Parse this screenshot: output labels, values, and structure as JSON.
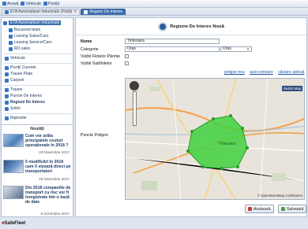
{
  "topbar": {
    "items": [
      {
        "label": "Acasă",
        "icon": "home-icon"
      },
      {
        "label": "Vehicule",
        "icon": "truck-icon"
      },
      {
        "label": "Poziții",
        "icon": "map-pin-icon"
      }
    ]
  },
  "tabs": [
    {
      "label": "ETA Automatizari Industriale (Flotă)",
      "active": false
    },
    {
      "label": "Regiuni De Interes",
      "active": true
    }
  ],
  "sidebar": {
    "items": [
      {
        "label": "ETA Automatizari Industriale",
        "icon": "folder-icon",
        "selected": true
      },
      {
        "label": "Bucuresti team",
        "icon": "folder-icon"
      },
      {
        "label": "Leasing Sales/Cars",
        "icon": "folder-icon"
      },
      {
        "label": "Leasing Service/Cars",
        "icon": "folder-icon"
      },
      {
        "label": "RO sales",
        "icon": "folder-icon"
      },
      {
        "label": "Vehicule",
        "icon": "truck-icon"
      },
      {
        "label": "Poziții Curente",
        "icon": "map-pin-icon"
      },
      {
        "label": "Trasee Plate",
        "icon": "route-icon"
      },
      {
        "label": "Carpool",
        "icon": "car-icon"
      },
      {
        "label": "Trasee",
        "icon": "route-icon"
      },
      {
        "label": "Puncte De Interes",
        "icon": "poi-icon"
      },
      {
        "label": "Regiuni De Interes",
        "icon": "region-icon",
        "bold": true
      },
      {
        "label": "Șoferi",
        "icon": "driver-icon"
      },
      {
        "label": "Rapoarte",
        "icon": "report-icon"
      }
    ]
  },
  "news": {
    "title": "Noutăți",
    "items": [
      {
        "text": "Cum vor arăta principalele costuri operaționale în 2018 ?",
        "date": "28 Noiembrie 2017"
      },
      {
        "text": "5 modificări în 2018 care îi vizează direct pe transportatori",
        "date": "28 Noiembrie 2017"
      },
      {
        "text": "Din 2018 companiile de transport cu risc vor fi înregistrate într-o bază de date",
        "date": "9 Octombrie 2017"
      }
    ]
  },
  "logo": {
    "text": "SafeFleet"
  },
  "form": {
    "title": "Regiune De Interes Nouă",
    "name_label": "Nume",
    "name_value": "Timisoara",
    "category_label": "Categorie",
    "category_value": "Oras",
    "category_select_value": "Oras",
    "parent_fleets_label": "Vizibil Flotelor Părinte",
    "subfleets_label": "Vizibil Subflotelor",
    "map_links": {
      "new_polygon": "poligon nou",
      "auto_center": "auto-centrare",
      "address_search": "căutare adresă"
    },
    "points_label": "Puncte Poligon",
    "switch_map": "Switch Map",
    "attribution": "© OpenStreetMap contributors",
    "map_place_label": "Timișoara",
    "cancel_label": "Anulează",
    "save_label": "Salvează"
  },
  "colors": {
    "accent": "#3c6fb0",
    "polygon_fill": "#3fd13f",
    "polygon_stroke": "#2a9b2a",
    "cancel_icon": "#c9382f",
    "save_icon": "#4da04a"
  }
}
